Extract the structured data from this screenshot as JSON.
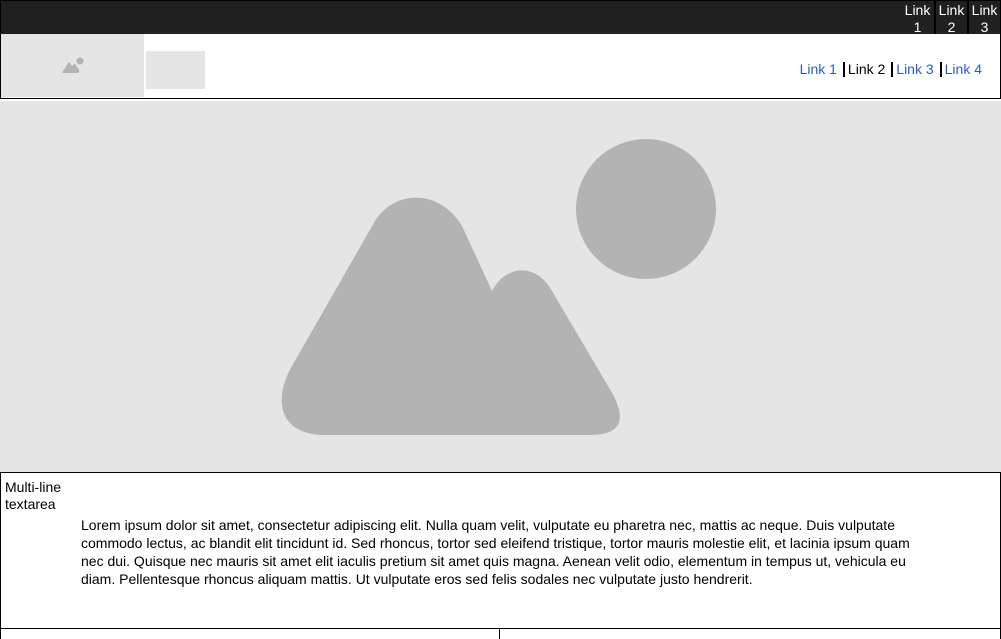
{
  "topbar": {
    "links": [
      {
        "label": "Link 1"
      },
      {
        "label": "Link 2"
      },
      {
        "label": "Link 3"
      }
    ]
  },
  "header": {
    "logo_icon": "image-placeholder-icon",
    "nav": [
      {
        "label": "Link 1",
        "state": "link"
      },
      {
        "label": "Link 2",
        "state": "current"
      },
      {
        "label": "Link 3",
        "state": "link"
      },
      {
        "label": "Link 4",
        "state": "link"
      }
    ]
  },
  "hero": {
    "icon": "image-placeholder-icon"
  },
  "textarea": {
    "label": "Multi-line textarea",
    "value": "Lorem ipsum dolor sit amet, consectetur adipiscing elit. Nulla quam velit, vulputate eu pharetra nec, mattis ac neque. Duis vulputate commodo lectus, ac blandit elit tincidunt id. Sed rhoncus, tortor sed eleifend tristique, tortor mauris molestie elit, et lacinia ipsum quam nec dui. Quisque nec mauris sit amet elit iaculis pretium sit amet quis magna. Aenean velit odio, elementum in tempus ut, vehicula eu diam. Pellentesque rhoncus aliquam mattis. Ut vulputate eros sed felis sodales nec vulputate justo hendrerit."
  },
  "colors": {
    "topbar_bg": "#202020",
    "link": "#2a5bd7",
    "placeholder_bg": "#e5e5e5",
    "placeholder_shape": "#b3b3b3"
  }
}
